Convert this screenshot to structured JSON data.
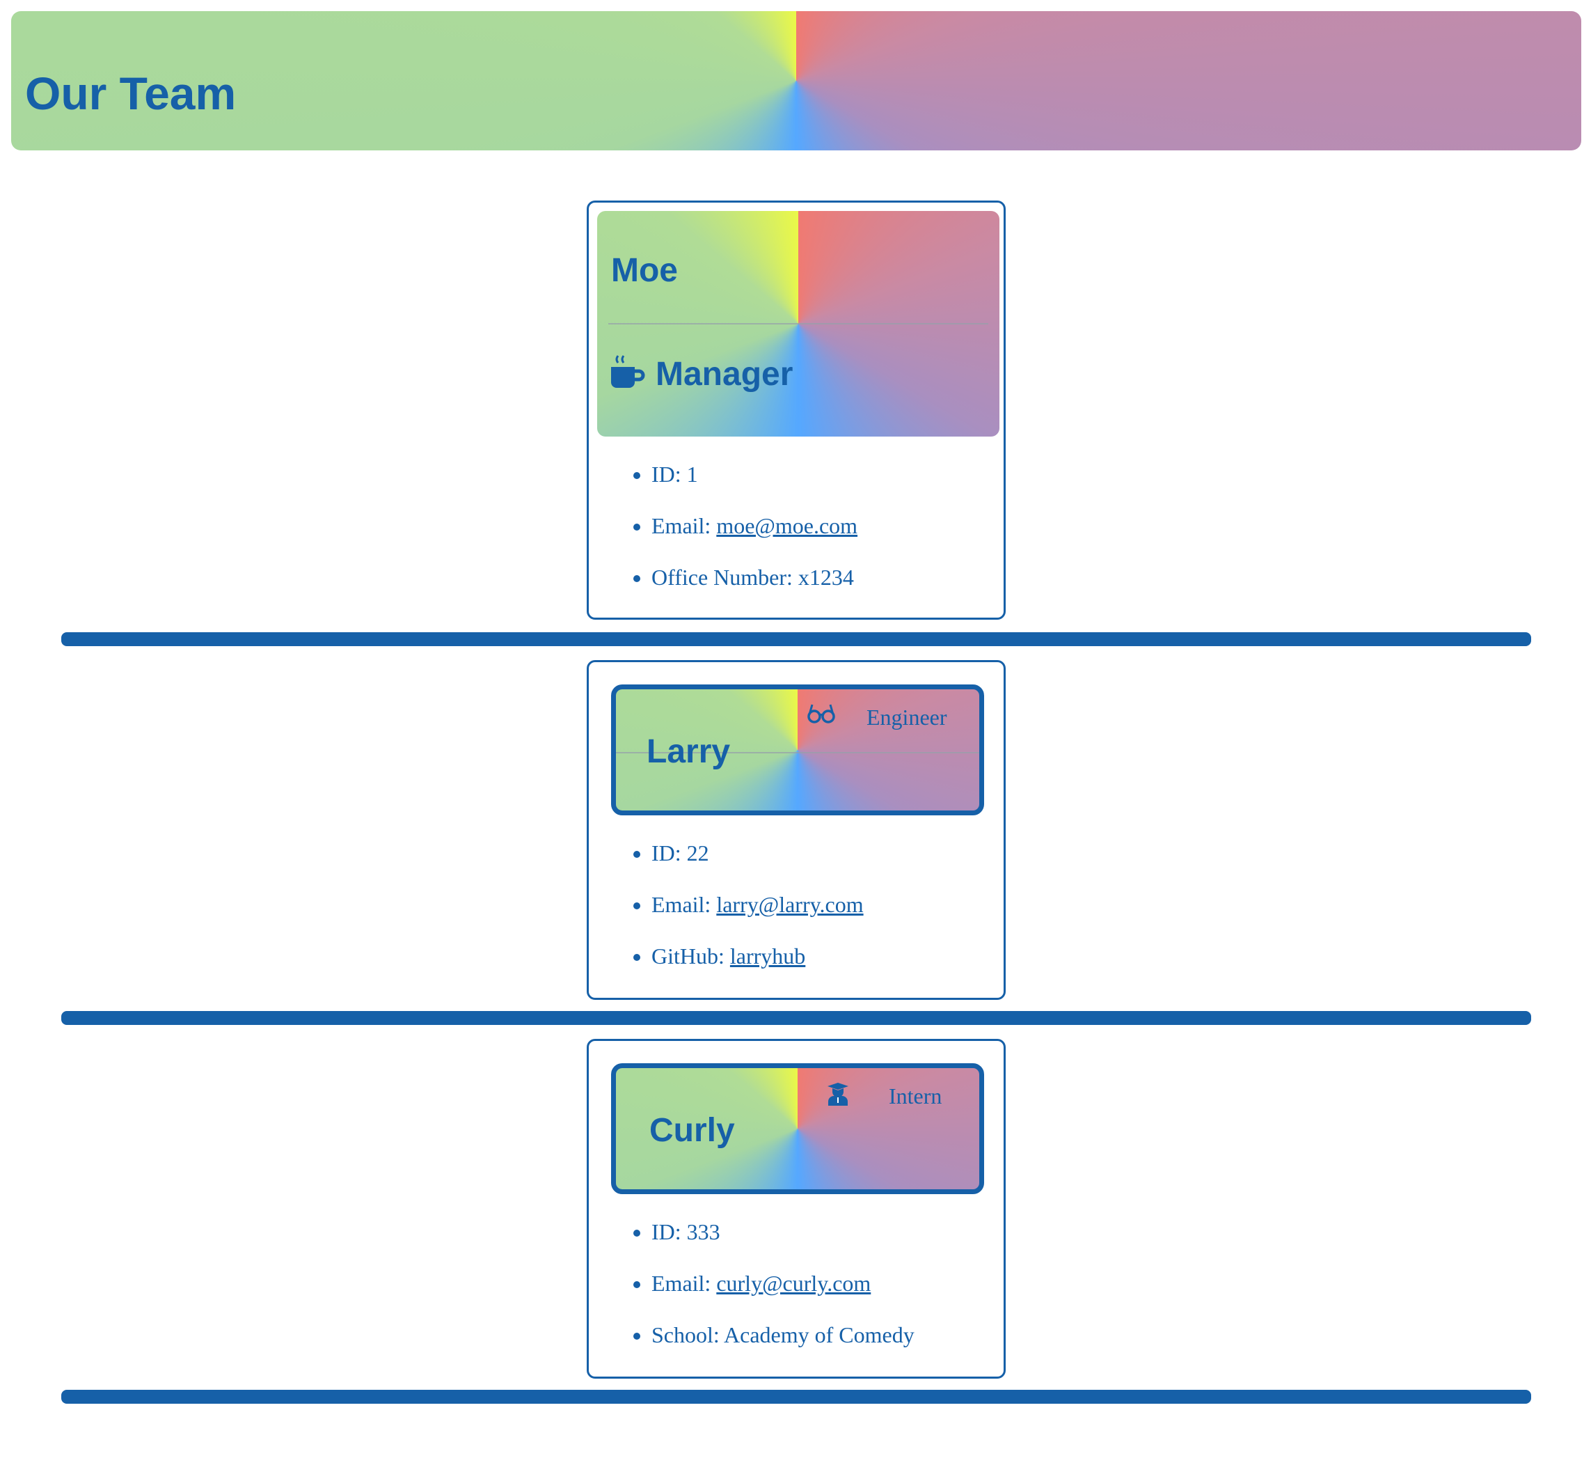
{
  "header": {
    "title": "Our Team"
  },
  "manager": {
    "name": "Moe",
    "role": "Manager",
    "role_icon": "coffee-cup-icon",
    "id_label": "ID: ",
    "id": "1",
    "email_label": "Email: ",
    "email": "moe@moe.com",
    "office_label": "Office Number: ",
    "office": "x1234"
  },
  "engineer": {
    "name": "Larry",
    "role": "Engineer",
    "role_icon": "glasses-icon",
    "id_label": "ID: ",
    "id": "22",
    "email_label": "Email: ",
    "email": "larry@larry.com",
    "github_label": "GitHub: ",
    "github": "larryhub"
  },
  "intern": {
    "name": "Curly",
    "role": "Intern",
    "role_icon": "graduate-icon",
    "id_label": "ID: ",
    "id": "333",
    "email_label": "Email: ",
    "email": "curly@curly.com",
    "school_label": "School: ",
    "school": "Academy of Comedy"
  },
  "colors": {
    "text": "#1660a8",
    "border": "#1660a8"
  }
}
